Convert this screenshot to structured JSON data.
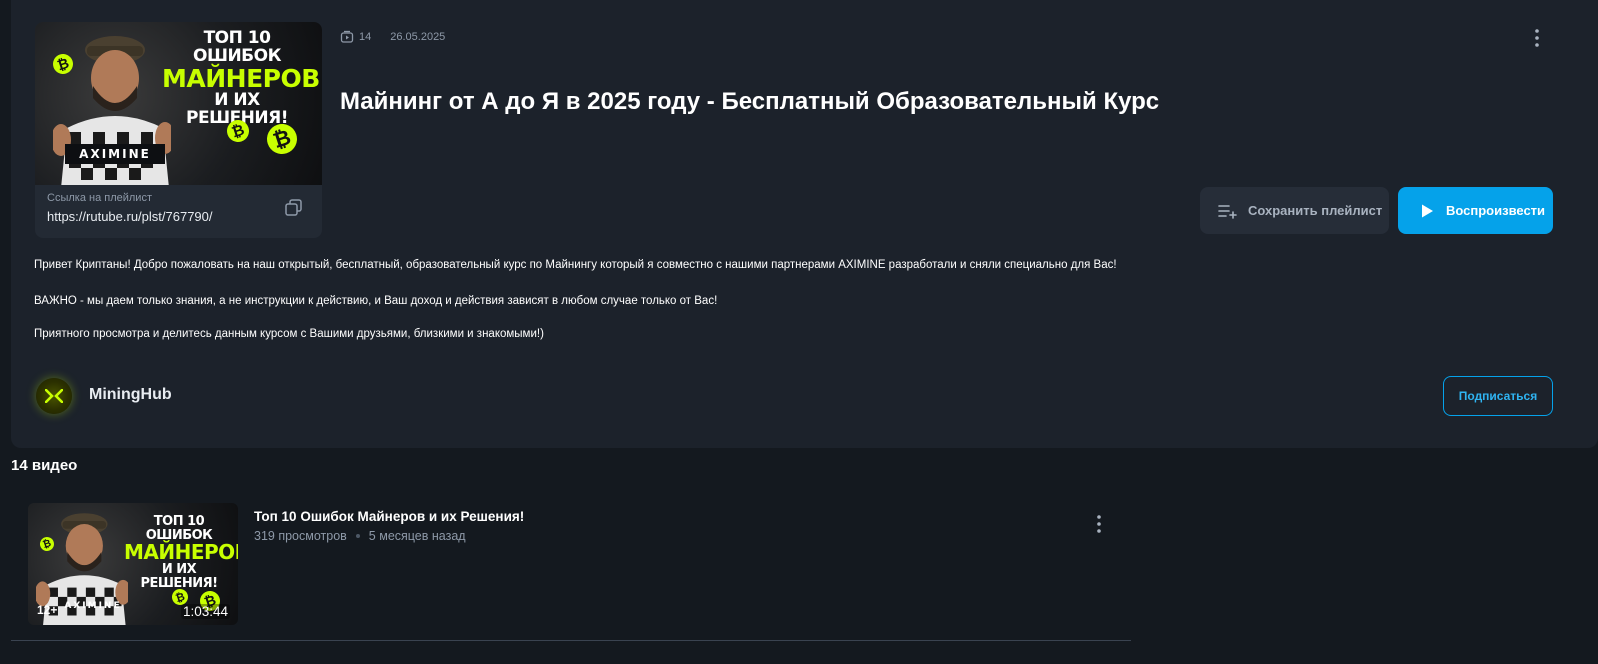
{
  "playlist": {
    "cover": {
      "headline_line1": "ТОП 10 ОШИБОК",
      "headline_line2": "МАЙНЕРОВ",
      "headline_line3": "И ИХ РЕШЕНИЯ!",
      "brand": "AXIMINE"
    },
    "link_label": "Ссылка на плейлист",
    "link_url": "https://rutube.ru/plst/767790/",
    "video_count": "14",
    "date": "26.05.2025",
    "title": "Майнинг от А до Я в 2025 году - Бесплатный Образовательный Курс",
    "save_label": "Сохранить плейлист",
    "play_label": "Воспроизвести",
    "description": [
      "Привет Криптаны! Добро пожаловать на наш открытый, бесплатный, образовательный курс по Майнингу который я совместно с нашими партнерами AXIMINE разработали и сняли специально для Вас!",
      "ВАЖНО - мы даем только знания, а не инструкции к действию, и Ваш доход и действия зависят в любом случае только от Вас!",
      "Приятного просмотра и делитесь данным курсом с Вашими друзьями, близкими и знакомыми!)"
    ],
    "channel_name": "MiningHub",
    "subscribe_label": "Подписаться"
  },
  "videos_heading": "14 видео",
  "videos": [
    {
      "title": "Топ 10 Ошибок Майнеров и их Решения!",
      "views": "319 просмотров",
      "age": "5 месяцев назад",
      "rating": "12+",
      "duration": "1:03:44",
      "thumb_line1": "ТОП 10 ОШИБОК",
      "thumb_line2": "МАЙНЕРОВ",
      "thumb_line3": "И ИХ РЕШЕНИЯ!",
      "thumb_brand": "AXIMINE"
    }
  ],
  "colors": {
    "accent": "#05a2ea",
    "brand_lime": "#c8ff00",
    "background": "#14191f",
    "card": "#1c222b"
  },
  "icons": [
    "playlist-count-icon",
    "more-vertical-icon",
    "copy-icon",
    "playlist-add-icon",
    "play-icon",
    "channel-logo-icon"
  ]
}
